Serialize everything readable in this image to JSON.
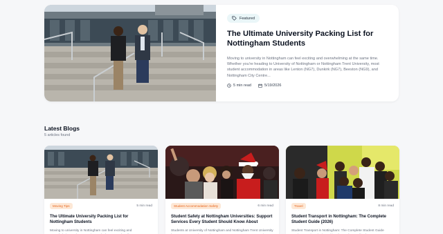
{
  "featured": {
    "badge": "Featured",
    "title": "The Ultimate University Packing List for Nottingham Students",
    "description": "Moving to university in Nottingham can feel exciting and overwhelming at the same time. Whether you're heading to University of Nottingham or Nottingham Trent University, most student accommodation in areas like Lenton (NG7), Dunkirk (NG7), Beeston (NG9), and Nottingham City Centre...",
    "read_time": "5 min read",
    "date": "5/19/2026",
    "icons": {
      "badge": "tag-icon",
      "time": "clock-icon",
      "date": "calendar-icon"
    }
  },
  "section": {
    "title": "Latest Blogs",
    "count": "5 articles found"
  },
  "cards": [
    {
      "category": "Moving Tips",
      "read_time": "5 min read",
      "title": "The Ultimate University Packing List for Nottingham Students",
      "excerpt": "Moving to university in Nottingham can feel exciting and overwhelming at the same time. Whether you're heading to Universit..."
    },
    {
      "category": "Student Accommodation Safety",
      "read_time": "6 min read",
      "title": "Student Safety at Nottingham Universities: Support Services Every Student Should Know About",
      "excerpt": "Students at University of Nottingham and Nottingham Trent University have access to 24/7 security teams, emergency response services..."
    },
    {
      "category": "Travel",
      "read_time": "8 min read",
      "title": "Student Transport in Nottingham: The Complete Student Guide (2026)",
      "excerpt": "Student Transport in Nottingham: The Complete Student Guide Moving to university is exciting, but understanding how to get aroun..."
    }
  ]
}
